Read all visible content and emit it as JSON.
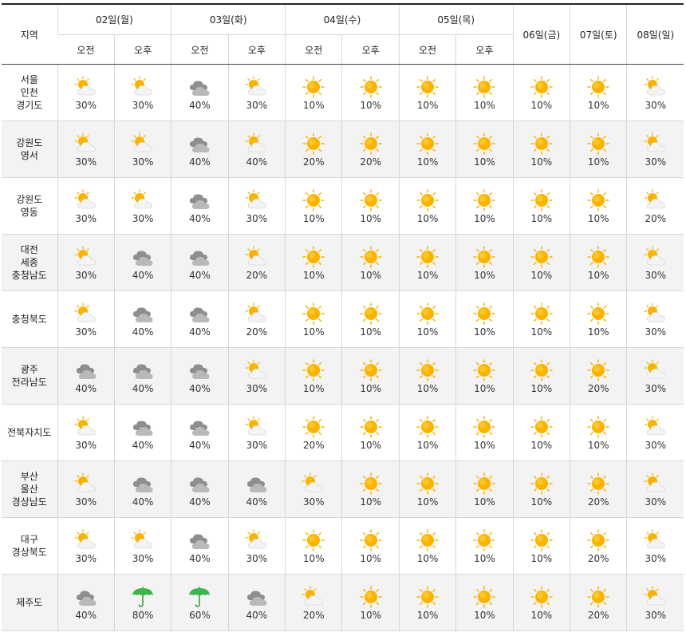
{
  "header": {
    "region_label": "지역",
    "days": [
      {
        "label": "02일(월)",
        "split": true
      },
      {
        "label": "03일(화)",
        "split": true
      },
      {
        "label": "04일(수)",
        "split": true
      },
      {
        "label": "05일(목)",
        "split": true
      },
      {
        "label": "06일(금)",
        "split": false
      },
      {
        "label": "07일(토)",
        "split": false
      },
      {
        "label": "08일(일)",
        "split": false
      }
    ],
    "am_label": "오전",
    "pm_label": "오후"
  },
  "rows": [
    {
      "region": "서울\n인천\n경기도",
      "cells": [
        {
          "icon": "partly-cloudy",
          "pct": "30%"
        },
        {
          "icon": "partly-cloudy",
          "pct": "30%"
        },
        {
          "icon": "cloudy",
          "pct": "40%"
        },
        {
          "icon": "partly-cloudy",
          "pct": "30%"
        },
        {
          "icon": "sunny",
          "pct": "10%"
        },
        {
          "icon": "sunny",
          "pct": "10%"
        },
        {
          "icon": "sunny",
          "pct": "10%"
        },
        {
          "icon": "sunny",
          "pct": "10%"
        },
        {
          "icon": "sunny",
          "pct": "10%"
        },
        {
          "icon": "sunny",
          "pct": "10%"
        },
        {
          "icon": "partly-cloudy",
          "pct": "30%"
        }
      ]
    },
    {
      "region": "강원도\n영서",
      "cells": [
        {
          "icon": "partly-cloudy",
          "pct": "30%"
        },
        {
          "icon": "partly-cloudy",
          "pct": "30%"
        },
        {
          "icon": "cloudy",
          "pct": "40%"
        },
        {
          "icon": "partly-cloudy",
          "pct": "40%"
        },
        {
          "icon": "sunny",
          "pct": "20%"
        },
        {
          "icon": "sunny",
          "pct": "20%"
        },
        {
          "icon": "sunny",
          "pct": "10%"
        },
        {
          "icon": "sunny",
          "pct": "10%"
        },
        {
          "icon": "sunny",
          "pct": "10%"
        },
        {
          "icon": "sunny",
          "pct": "10%"
        },
        {
          "icon": "partly-cloudy",
          "pct": "30%"
        }
      ]
    },
    {
      "region": "강원도\n영동",
      "cells": [
        {
          "icon": "partly-cloudy",
          "pct": "30%"
        },
        {
          "icon": "partly-cloudy",
          "pct": "30%"
        },
        {
          "icon": "cloudy",
          "pct": "40%"
        },
        {
          "icon": "partly-cloudy",
          "pct": "30%"
        },
        {
          "icon": "sunny",
          "pct": "10%"
        },
        {
          "icon": "sunny",
          "pct": "10%"
        },
        {
          "icon": "sunny",
          "pct": "10%"
        },
        {
          "icon": "sunny",
          "pct": "10%"
        },
        {
          "icon": "sunny",
          "pct": "10%"
        },
        {
          "icon": "sunny",
          "pct": "10%"
        },
        {
          "icon": "partly-cloudy",
          "pct": "20%"
        }
      ]
    },
    {
      "region": "대전\n세종\n충청남도",
      "cells": [
        {
          "icon": "partly-cloudy",
          "pct": "30%"
        },
        {
          "icon": "cloudy",
          "pct": "40%"
        },
        {
          "icon": "cloudy",
          "pct": "40%"
        },
        {
          "icon": "partly-cloudy",
          "pct": "20%"
        },
        {
          "icon": "sunny",
          "pct": "10%"
        },
        {
          "icon": "sunny",
          "pct": "10%"
        },
        {
          "icon": "sunny",
          "pct": "10%"
        },
        {
          "icon": "sunny",
          "pct": "10%"
        },
        {
          "icon": "sunny",
          "pct": "10%"
        },
        {
          "icon": "sunny",
          "pct": "10%"
        },
        {
          "icon": "partly-cloudy",
          "pct": "30%"
        }
      ]
    },
    {
      "region": "충청북도",
      "cells": [
        {
          "icon": "partly-cloudy",
          "pct": "30%"
        },
        {
          "icon": "cloudy",
          "pct": "40%"
        },
        {
          "icon": "cloudy",
          "pct": "40%"
        },
        {
          "icon": "partly-cloudy",
          "pct": "20%"
        },
        {
          "icon": "sunny",
          "pct": "10%"
        },
        {
          "icon": "sunny",
          "pct": "10%"
        },
        {
          "icon": "sunny",
          "pct": "10%"
        },
        {
          "icon": "sunny",
          "pct": "10%"
        },
        {
          "icon": "sunny",
          "pct": "10%"
        },
        {
          "icon": "sunny",
          "pct": "10%"
        },
        {
          "icon": "partly-cloudy",
          "pct": "30%"
        }
      ]
    },
    {
      "region": "광주\n전라남도",
      "cells": [
        {
          "icon": "cloudy",
          "pct": "40%"
        },
        {
          "icon": "cloudy",
          "pct": "40%"
        },
        {
          "icon": "cloudy",
          "pct": "40%"
        },
        {
          "icon": "partly-cloudy",
          "pct": "30%"
        },
        {
          "icon": "sunny",
          "pct": "10%"
        },
        {
          "icon": "sunny",
          "pct": "10%"
        },
        {
          "icon": "sunny",
          "pct": "10%"
        },
        {
          "icon": "sunny",
          "pct": "10%"
        },
        {
          "icon": "sunny",
          "pct": "10%"
        },
        {
          "icon": "sunny",
          "pct": "20%"
        },
        {
          "icon": "partly-cloudy",
          "pct": "30%"
        }
      ]
    },
    {
      "region": "전북자치도",
      "cells": [
        {
          "icon": "partly-cloudy",
          "pct": "30%"
        },
        {
          "icon": "cloudy",
          "pct": "40%"
        },
        {
          "icon": "cloudy",
          "pct": "40%"
        },
        {
          "icon": "partly-cloudy",
          "pct": "30%"
        },
        {
          "icon": "sunny",
          "pct": "20%"
        },
        {
          "icon": "sunny",
          "pct": "10%"
        },
        {
          "icon": "sunny",
          "pct": "10%"
        },
        {
          "icon": "sunny",
          "pct": "10%"
        },
        {
          "icon": "sunny",
          "pct": "10%"
        },
        {
          "icon": "sunny",
          "pct": "10%"
        },
        {
          "icon": "partly-cloudy",
          "pct": "30%"
        }
      ]
    },
    {
      "region": "부산\n울산\n경상남도",
      "cells": [
        {
          "icon": "partly-cloudy",
          "pct": "30%"
        },
        {
          "icon": "cloudy",
          "pct": "40%"
        },
        {
          "icon": "cloudy",
          "pct": "40%"
        },
        {
          "icon": "cloudy",
          "pct": "40%"
        },
        {
          "icon": "partly-cloudy",
          "pct": "30%"
        },
        {
          "icon": "sunny",
          "pct": "10%"
        },
        {
          "icon": "sunny",
          "pct": "10%"
        },
        {
          "icon": "sunny",
          "pct": "10%"
        },
        {
          "icon": "sunny",
          "pct": "10%"
        },
        {
          "icon": "sunny",
          "pct": "20%"
        },
        {
          "icon": "partly-cloudy",
          "pct": "30%"
        }
      ]
    },
    {
      "region": "대구\n경상북도",
      "cells": [
        {
          "icon": "partly-cloudy",
          "pct": "30%"
        },
        {
          "icon": "partly-cloudy",
          "pct": "30%"
        },
        {
          "icon": "cloudy",
          "pct": "40%"
        },
        {
          "icon": "partly-cloudy",
          "pct": "30%"
        },
        {
          "icon": "sunny",
          "pct": "10%"
        },
        {
          "icon": "sunny",
          "pct": "10%"
        },
        {
          "icon": "sunny",
          "pct": "10%"
        },
        {
          "icon": "sunny",
          "pct": "10%"
        },
        {
          "icon": "sunny",
          "pct": "10%"
        },
        {
          "icon": "sunny",
          "pct": "20%"
        },
        {
          "icon": "partly-cloudy",
          "pct": "30%"
        }
      ]
    },
    {
      "region": "제주도",
      "cells": [
        {
          "icon": "cloudy",
          "pct": "40%"
        },
        {
          "icon": "rain",
          "pct": "80%"
        },
        {
          "icon": "rain",
          "pct": "60%"
        },
        {
          "icon": "cloudy",
          "pct": "40%"
        },
        {
          "icon": "partly-cloudy",
          "pct": "20%"
        },
        {
          "icon": "sunny",
          "pct": "10%"
        },
        {
          "icon": "sunny",
          "pct": "10%"
        },
        {
          "icon": "sunny",
          "pct": "10%"
        },
        {
          "icon": "sunny",
          "pct": "10%"
        },
        {
          "icon": "sunny",
          "pct": "20%"
        },
        {
          "icon": "partly-cloudy",
          "pct": "30%"
        }
      ]
    }
  ],
  "colors": {
    "sun": "#f8b400",
    "cloud_gray": "#9a9a9a",
    "umbrella": "#3eb54a"
  }
}
